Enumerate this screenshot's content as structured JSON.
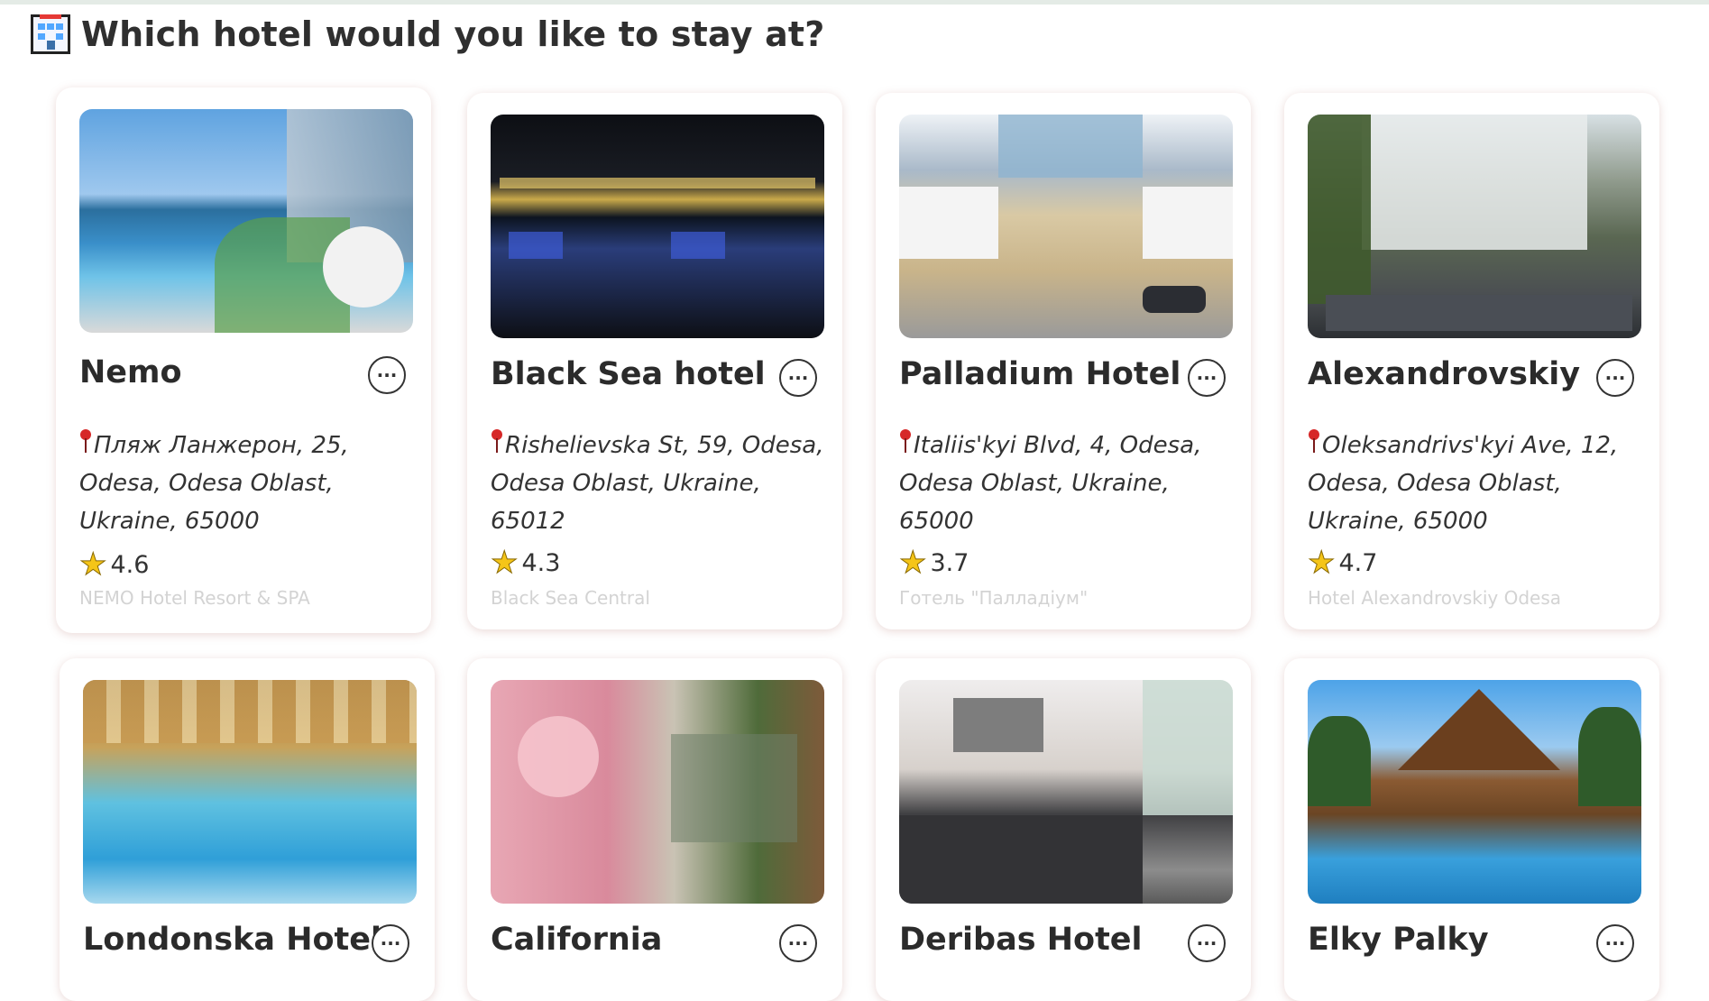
{
  "page": {
    "heading": "Which hotel would you like to stay at?",
    "heading_icon": "hotel-emoji",
    "more_label": "···"
  },
  "hotels": [
    {
      "name": "Nemo",
      "address": "Пляж Ланжерон, 25, Odesa, Odesa Oblast, Ukraine, 65000",
      "rating": "4.6",
      "google_name": "NEMO Hotel Resort & SPA"
    },
    {
      "name": "Black Sea hotel",
      "address": "Rishelievska St, 59, Odesa, Odesa Oblast, Ukraine, 65012",
      "rating": "4.3",
      "google_name": "Black Sea Central"
    },
    {
      "name": "Palladium Hotel",
      "address": "Italiis'kyi Blvd, 4, Odesa, Odesa Oblast, Ukraine, 65000",
      "rating": "3.7",
      "google_name": "Готель \"Палладіум\""
    },
    {
      "name": "Alexandrovskiy",
      "address": "Oleksandrivs'kyi Ave, 12, Odesa, Odesa Oblast, Ukraine, 65000",
      "rating": "4.7",
      "google_name": "Hotel Alexandrovskiy Odesa"
    },
    {
      "name": "Londonska Hotel"
    },
    {
      "name": "California"
    },
    {
      "name": "Deribas Hotel"
    },
    {
      "name": "Elky Palky"
    }
  ],
  "colors": {
    "pin": "#d62828",
    "star": "#f5c518",
    "google_name": "#d3d3d3"
  }
}
